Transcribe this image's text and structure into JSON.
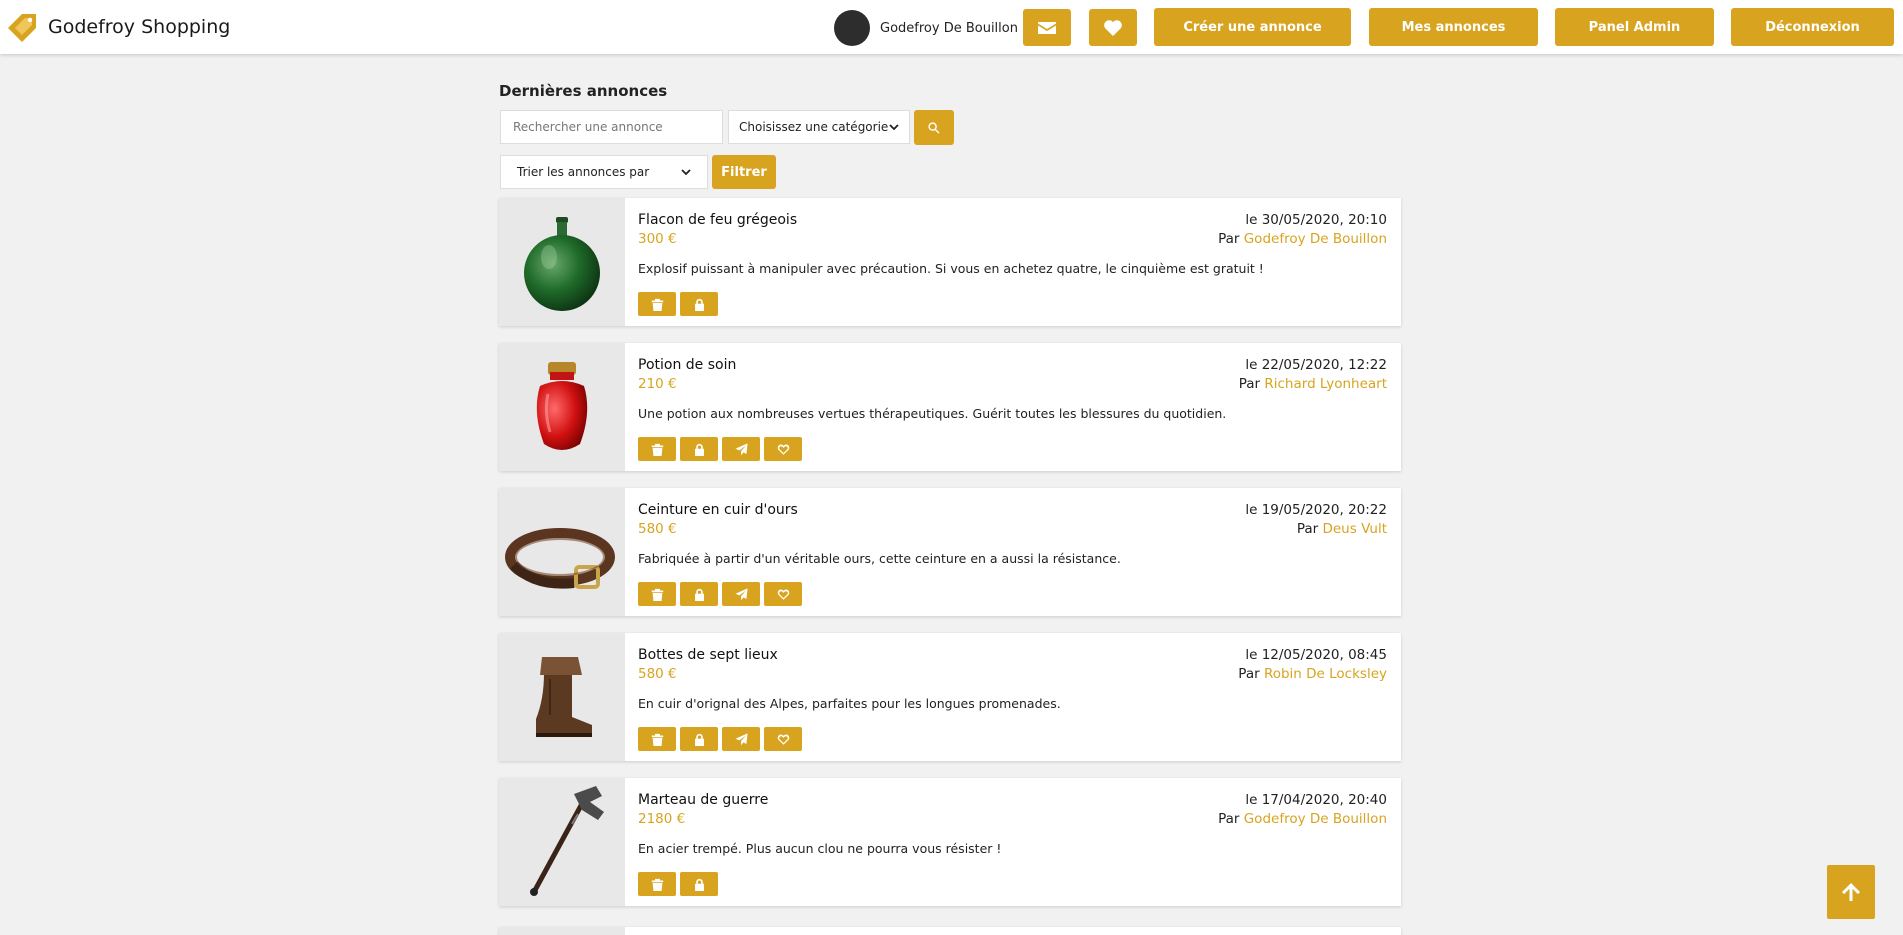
{
  "brand": {
    "name": "Godefroy Shopping",
    "logo_icon": "tag-logo-icon"
  },
  "user": {
    "name": "Godefroy De Bouillon"
  },
  "nav": {
    "messages_icon": "envelope-icon",
    "favorites_icon": "heart-icon",
    "create_label": "Créer une annonce",
    "my_ads_label": "Mes annonces",
    "admin_label": "Panel Admin",
    "logout_label": "Déconnexion"
  },
  "page": {
    "title": "Dernières annonces"
  },
  "search": {
    "placeholder": "Rechercher une annonce",
    "category_selected": "Choisissez une catégorie",
    "sort_selected": "Trier les annonces par",
    "filter_label": "Filtrer"
  },
  "colors": {
    "accent": "#d8a420",
    "background": "#f1f1f1",
    "card": "#ffffff",
    "thumb_bg": "#e8e8e8"
  },
  "listings": [
    {
      "title": "Flacon de feu grégeois",
      "price": "300 €",
      "date": "le 30/05/2020, 20:10",
      "by_prefix": "Par",
      "author": "Godefroy De Bouillon",
      "description": "Explosif puissant à manipuler avec précaution. Si vous en achetez quatre, le cinquième est gratuit !",
      "image": "green-flask-image",
      "actions": [
        "trash-icon",
        "lock-icon"
      ]
    },
    {
      "title": "Potion de soin",
      "price": "210 €",
      "date": "le 22/05/2020, 12:22",
      "by_prefix": "Par",
      "author": "Richard Lyonheart",
      "description": "Une potion aux nombreuses vertues thérapeutiques. Guérit toutes les blessures du quotidien.",
      "image": "red-potion-image",
      "actions": [
        "trash-icon",
        "lock-icon",
        "paper-plane-icon",
        "heart-outline-icon"
      ]
    },
    {
      "title": "Ceinture en cuir d'ours",
      "price": "580 €",
      "date": "le 19/05/2020, 20:22",
      "by_prefix": "Par",
      "author": "Deus Vult",
      "description": "Fabriquée à partir d'un véritable ours, cette ceinture en a aussi la résistance.",
      "image": "leather-belt-image",
      "actions": [
        "trash-icon",
        "lock-icon",
        "paper-plane-icon",
        "heart-outline-icon"
      ]
    },
    {
      "title": "Bottes de sept lieux",
      "price": "580 €",
      "date": "le 12/05/2020, 08:45",
      "by_prefix": "Par",
      "author": "Robin De Locksley",
      "description": "En cuir d'orignal des Alpes, parfaites pour les longues promenades.",
      "image": "leather-boot-image",
      "actions": [
        "trash-icon",
        "lock-icon",
        "paper-plane-icon",
        "heart-outline-icon"
      ]
    },
    {
      "title": "Marteau de guerre",
      "price": "2180 €",
      "date": "le 17/04/2020, 20:40",
      "by_prefix": "Par",
      "author": "Godefroy De Bouillon",
      "description": "En acier trempé. Plus aucun clou ne pourra vous résister !",
      "image": "war-hammer-image",
      "actions": [
        "trash-icon",
        "lock-icon"
      ]
    }
  ],
  "scroll_top_icon": "arrow-up-icon"
}
